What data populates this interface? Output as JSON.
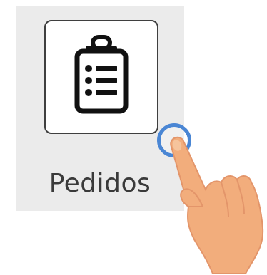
{
  "app_tile": {
    "label": "Pedidos",
    "icon": "clipboard-list-icon"
  },
  "overlay": {
    "gesture": "tap",
    "hand_icon": "pointing-hand-icon",
    "ring_color": "#4a86d4"
  },
  "colors": {
    "tile_background": "#ebebeb",
    "icon_stroke": "#111111",
    "label": "#3a3a3a",
    "skin": "#f2ad7c"
  }
}
